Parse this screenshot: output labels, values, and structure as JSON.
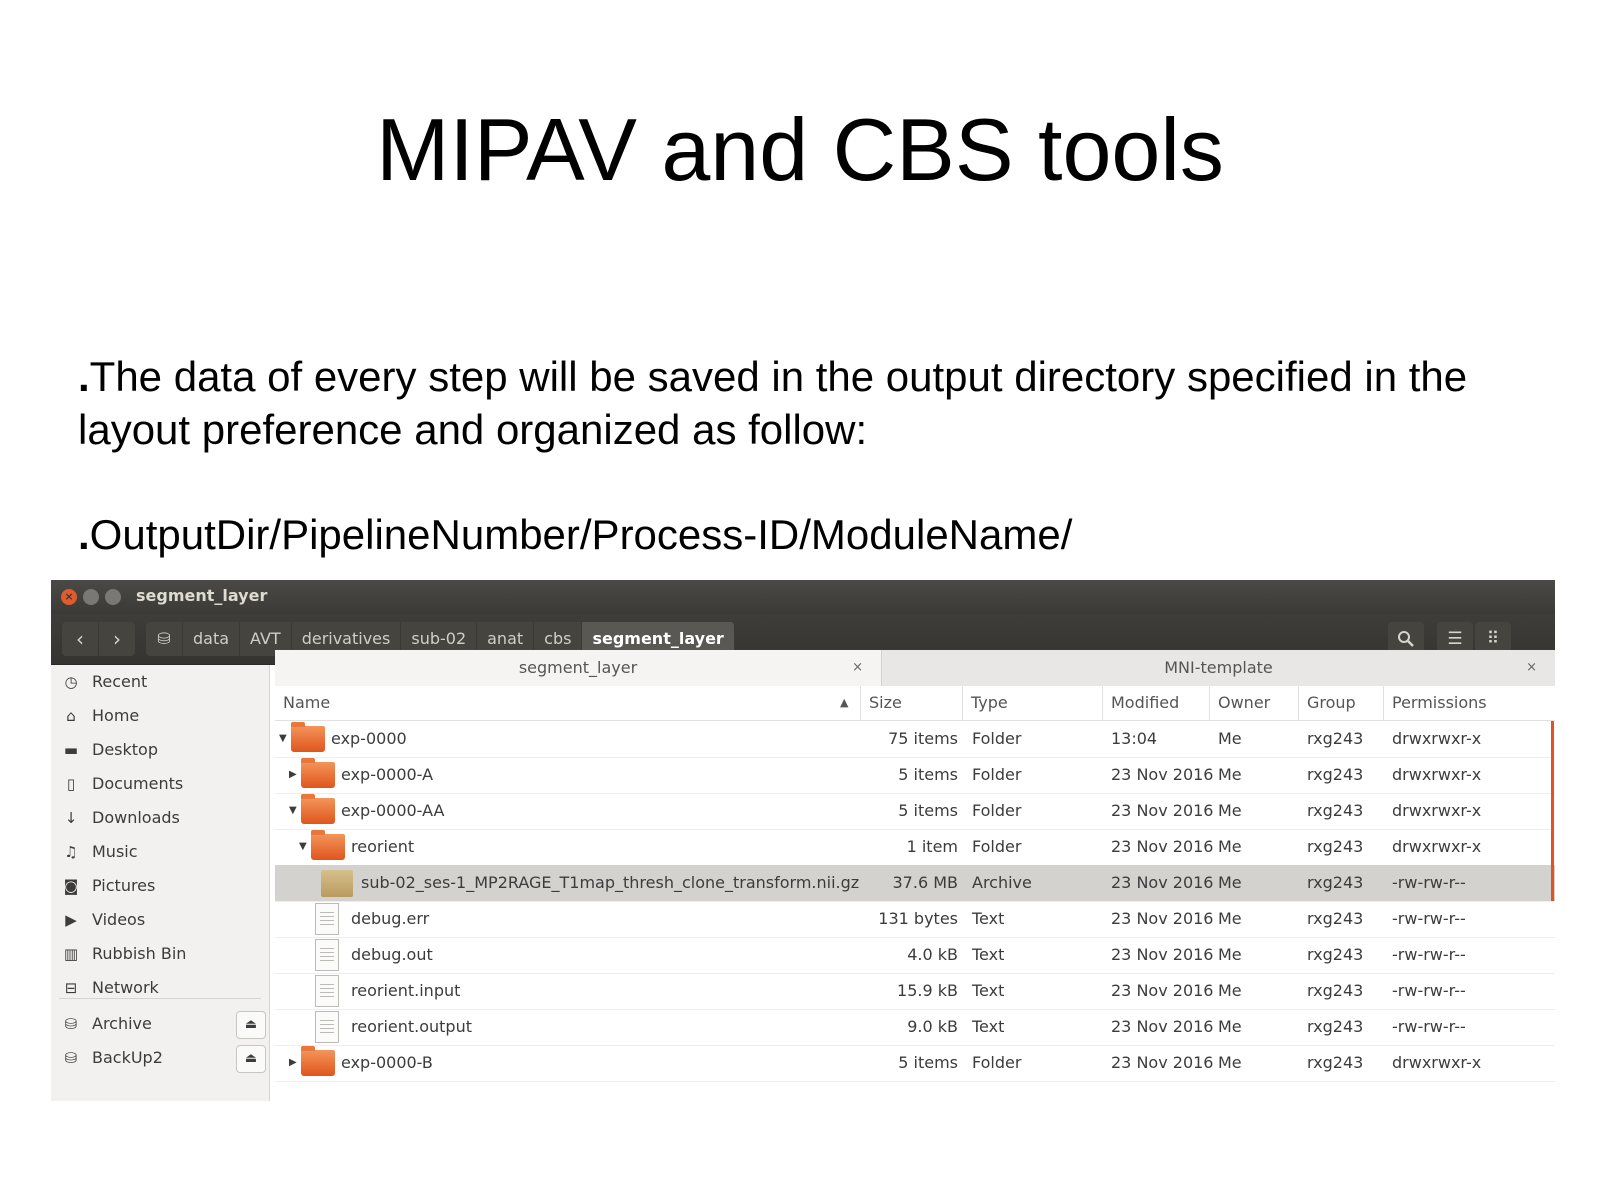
{
  "slide": {
    "title": "MIPAV and CBS tools",
    "bullets": [
      "The data of every step will be saved in the output directory specified in the layout preference and organized as follow:",
      "OutputDir/PipelineNumber/Process-ID/ModuleName/"
    ]
  },
  "window": {
    "title": "segment_layer",
    "breadcrumbs": [
      "data",
      "AVT",
      "derivatives",
      "sub-02",
      "anat",
      "cbs",
      "segment_layer"
    ]
  },
  "sidebar": {
    "places": [
      {
        "label": "Recent",
        "icon": "clock-icon"
      },
      {
        "label": "Home",
        "icon": "home-icon"
      },
      {
        "label": "Desktop",
        "icon": "desktop-folder-icon"
      },
      {
        "label": "Documents",
        "icon": "document-icon"
      },
      {
        "label": "Downloads",
        "icon": "download-icon"
      },
      {
        "label": "Music",
        "icon": "music-icon"
      },
      {
        "label": "Pictures",
        "icon": "camera-icon"
      },
      {
        "label": "Videos",
        "icon": "video-icon"
      },
      {
        "label": "Rubbish Bin",
        "icon": "trash-icon"
      },
      {
        "label": "Network",
        "icon": "network-icon"
      }
    ],
    "devices": [
      {
        "label": "Archive",
        "icon": "drive-icon"
      },
      {
        "label": "BackUp2",
        "icon": "drive-icon"
      }
    ]
  },
  "tabs": [
    {
      "label": "segment_layer",
      "close": "×"
    },
    {
      "label": "MNI-template",
      "close": "×"
    }
  ],
  "columns": {
    "name": "Name",
    "size": "Size",
    "type": "Type",
    "modified": "Modified",
    "owner": "Owner",
    "group": "Group",
    "permissions": "Permissions"
  },
  "rows": [
    {
      "name": "exp-0000",
      "size": "75 items",
      "type": "Folder",
      "modified": "13:04",
      "owner": "Me",
      "group": "rxg243",
      "permissions": "drwxrwxr-x"
    },
    {
      "name": "exp-0000-A",
      "size": "5 items",
      "type": "Folder",
      "modified": "23 Nov 2016",
      "owner": "Me",
      "group": "rxg243",
      "permissions": "drwxrwxr-x"
    },
    {
      "name": "exp-0000-AA",
      "size": "5 items",
      "type": "Folder",
      "modified": "23 Nov 2016",
      "owner": "Me",
      "group": "rxg243",
      "permissions": "drwxrwxr-x"
    },
    {
      "name": "reorient",
      "size": "1 item",
      "type": "Folder",
      "modified": "23 Nov 2016",
      "owner": "Me",
      "group": "rxg243",
      "permissions": "drwxrwxr-x"
    },
    {
      "name": "sub-02_ses-1_MP2RAGE_T1map_thresh_clone_transform.nii.gz",
      "size": "37.6 MB",
      "type": "Archive",
      "modified": "23 Nov 2016",
      "owner": "Me",
      "group": "rxg243",
      "permissions": "-rw-rw-r--"
    },
    {
      "name": "debug.err",
      "size": "131 bytes",
      "type": "Text",
      "modified": "23 Nov 2016",
      "owner": "Me",
      "group": "rxg243",
      "permissions": "-rw-rw-r--"
    },
    {
      "name": "debug.out",
      "size": "4.0 kB",
      "type": "Text",
      "modified": "23 Nov 2016",
      "owner": "Me",
      "group": "rxg243",
      "permissions": "-rw-rw-r--"
    },
    {
      "name": "reorient.input",
      "size": "15.9 kB",
      "type": "Text",
      "modified": "23 Nov 2016",
      "owner": "Me",
      "group": "rxg243",
      "permissions": "-rw-rw-r--"
    },
    {
      "name": "reorient.output",
      "size": "9.0 kB",
      "type": "Text",
      "modified": "23 Nov 2016",
      "owner": "Me",
      "group": "rxg243",
      "permissions": "-rw-rw-r--"
    },
    {
      "name": "exp-0000-B",
      "size": "5 items",
      "type": "Folder",
      "modified": "23 Nov 2016",
      "owner": "Me",
      "group": "rxg243",
      "permissions": "drwxrwxr-x"
    }
  ],
  "colors": {
    "accent": "#e0551d",
    "titlebar": "#3b3a36",
    "selected_row": "#d4d2cf"
  }
}
